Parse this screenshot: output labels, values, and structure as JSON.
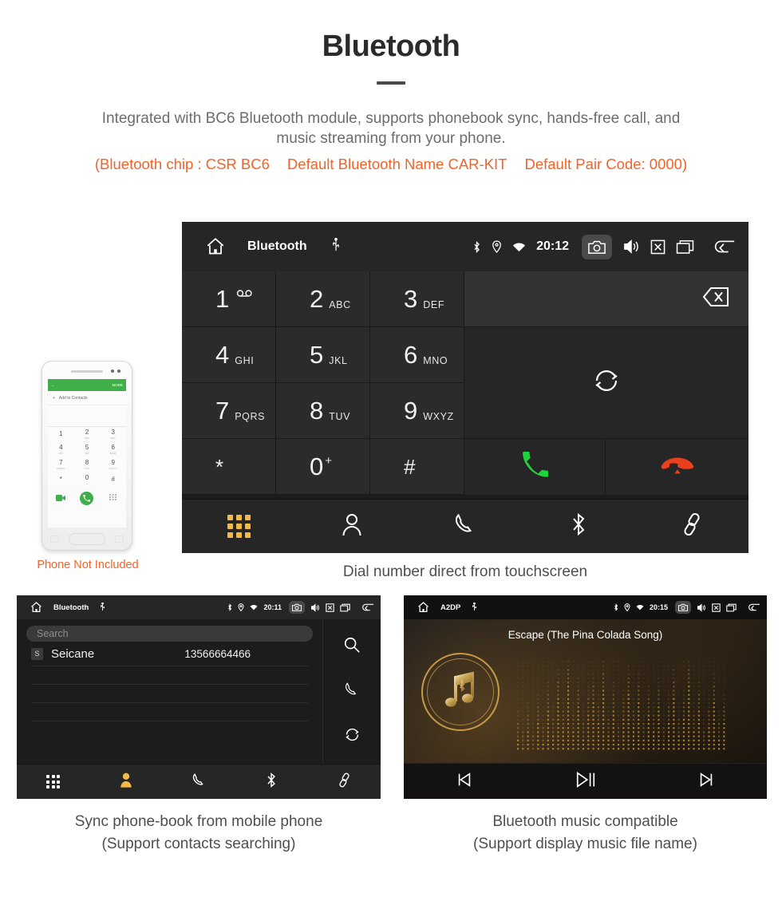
{
  "header": {
    "title": "Bluetooth",
    "description_line1": "Integrated with BC6 Bluetooth module, supports phonebook sync, hands-free call, and",
    "description_line2": "music streaming from your phone.",
    "spec_chip": "(Bluetooth chip : CSR BC6",
    "spec_name": "Default Bluetooth Name CAR-KIT",
    "spec_pair": "Default Pair Code: 0000)",
    "accent_color": "#f0642a",
    "body_color": "#6d6d6d"
  },
  "phone_mock": {
    "caption": "Phone Not Included",
    "appbar_more": "MORE",
    "add_to_contacts": "Add to Contacts",
    "keys": [
      {
        "digit": "1",
        "letters": ""
      },
      {
        "digit": "2",
        "letters": "ABC"
      },
      {
        "digit": "3",
        "letters": "DEF"
      },
      {
        "digit": "4",
        "letters": "GHI"
      },
      {
        "digit": "5",
        "letters": "JKL"
      },
      {
        "digit": "6",
        "letters": "MNO"
      },
      {
        "digit": "7",
        "letters": "PQRS"
      },
      {
        "digit": "8",
        "letters": "TUV"
      },
      {
        "digit": "9",
        "letters": "WXYZ"
      },
      {
        "digit": "*",
        "letters": ""
      },
      {
        "digit": "0",
        "letters": "+"
      },
      {
        "digit": "#",
        "letters": ""
      }
    ]
  },
  "main_unit": {
    "statusbar": {
      "title": "Bluetooth",
      "time": "20:12",
      "icons": [
        "home-icon",
        "usb-icon",
        "bluetooth-icon",
        "location-icon",
        "wifi-icon",
        "camera-icon",
        "volume-icon",
        "close-icon",
        "recents-icon",
        "back-icon"
      ]
    },
    "keys": [
      {
        "digit": "1",
        "letters": "",
        "voicemail": true
      },
      {
        "digit": "2",
        "letters": "ABC"
      },
      {
        "digit": "3",
        "letters": "DEF"
      },
      {
        "digit": "4",
        "letters": "GHI"
      },
      {
        "digit": "5",
        "letters": "JKL"
      },
      {
        "digit": "6",
        "letters": "MNO"
      },
      {
        "digit": "7",
        "letters": "PQRS"
      },
      {
        "digit": "8",
        "letters": "TUV"
      },
      {
        "digit": "9",
        "letters": "WXYZ"
      },
      {
        "digit": "*",
        "letters": ""
      },
      {
        "digit": "0",
        "superscript": "+"
      },
      {
        "digit": "#",
        "letters": ""
      }
    ],
    "number_display_value": "",
    "call_color": "#1fd43a",
    "hangup_color": "#e8401c",
    "tabs": [
      {
        "name": "dialpad",
        "active": true
      },
      {
        "name": "contacts",
        "active": false
      },
      {
        "name": "call-log",
        "active": false
      },
      {
        "name": "bluetooth",
        "active": false
      },
      {
        "name": "pair-link",
        "active": false
      }
    ],
    "active_tab_color": "#f4b844",
    "caption": "Dial number direct from touchscreen"
  },
  "contacts_unit": {
    "statusbar": {
      "title": "Bluetooth",
      "time": "20:11"
    },
    "search_placeholder": "Search",
    "contacts": [
      {
        "initial": "S",
        "name": "Seicane",
        "number": "13566664466"
      }
    ],
    "side_actions": [
      "search-icon",
      "call-icon",
      "sync-icon"
    ],
    "tabs": [
      {
        "name": "dialpad",
        "active": false
      },
      {
        "name": "contacts",
        "active": true
      },
      {
        "name": "call-log",
        "active": false
      },
      {
        "name": "bluetooth",
        "active": false
      },
      {
        "name": "pair-link",
        "active": false
      }
    ],
    "caption_line1": "Sync phone-book from mobile phone",
    "caption_line2": "(Support contacts searching)"
  },
  "music_unit": {
    "statusbar": {
      "title": "A2DP",
      "time": "20:15"
    },
    "track_title": "Escape (The Pina Colada Song)",
    "controls": [
      "previous-icon",
      "play-pause-icon",
      "next-icon"
    ],
    "accent_color": "#c89a46",
    "caption_line1": "Bluetooth music compatible",
    "caption_line2": "(Support display music file name)"
  }
}
